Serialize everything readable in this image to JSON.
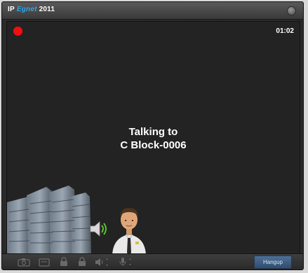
{
  "window": {
    "title_prefix": "IP",
    "title_brand": "Egnet",
    "title_year": "2011"
  },
  "call": {
    "timer": "01:02",
    "status_line1": "Talking to",
    "status_line2": "C Block-0006",
    "recording_color": "#ee1111"
  },
  "toolbar": {
    "icons": [
      "camera-icon",
      "video-icon",
      "door-lock-icon",
      "lock-icon",
      "volume-icon",
      "microphone-icon"
    ],
    "hangup_label": "Hangup"
  },
  "colors": {
    "brand": "#29a6e8",
    "stage_bg": "#232323",
    "hangup_bg": "#3d5c80"
  }
}
